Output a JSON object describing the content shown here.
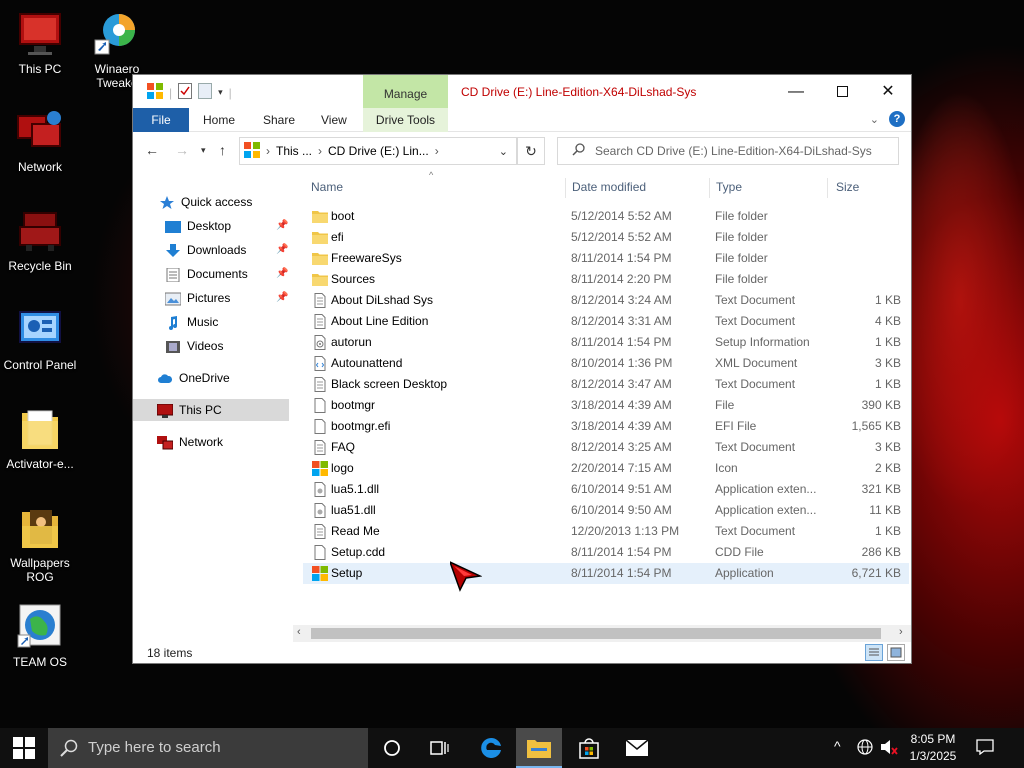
{
  "desktop": {
    "icons": [
      {
        "label": "This PC"
      },
      {
        "label": "Winaero Tweake"
      },
      {
        "label": "Network"
      },
      {
        "label": "Recycle Bin"
      },
      {
        "label": "Control Panel"
      },
      {
        "label": "Activator-e..."
      },
      {
        "label": "Wallpapers ROG"
      },
      {
        "label": "TEAM OS"
      }
    ]
  },
  "window": {
    "title": "CD Drive (E:) Line-Edition-X64-DiLshad-Sys",
    "manage_tab": "Manage",
    "ribbon_tabs": [
      "File",
      "Home",
      "Share",
      "View",
      "Drive Tools"
    ],
    "address": {
      "crumbs": [
        "This ...",
        "CD Drive (E:) Lin..."
      ]
    },
    "search_placeholder": "Search CD Drive (E:) Line-Edition-X64-DiLshad-Sys",
    "nav": [
      {
        "label": "Quick access",
        "icon": "star-icon"
      },
      {
        "label": "Desktop",
        "icon": "desktop-icon",
        "pinned": true
      },
      {
        "label": "Downloads",
        "icon": "download-icon",
        "pinned": true
      },
      {
        "label": "Documents",
        "icon": "documents-icon",
        "pinned": true
      },
      {
        "label": "Pictures",
        "icon": "pictures-icon",
        "pinned": true
      },
      {
        "label": "Music",
        "icon": "music-icon"
      },
      {
        "label": "Videos",
        "icon": "videos-icon"
      },
      {
        "label": "OneDrive",
        "icon": "cloud-icon"
      },
      {
        "label": "This PC",
        "icon": "computer-icon"
      },
      {
        "label": "Network",
        "icon": "network-icon"
      }
    ],
    "columns": [
      "Name",
      "Date modified",
      "Type",
      "Size"
    ],
    "files": [
      {
        "name": "boot",
        "date": "5/12/2014 5:52 AM",
        "type": "File folder",
        "size": "",
        "icon": "folder-icon"
      },
      {
        "name": "efi",
        "date": "5/12/2014 5:52 AM",
        "type": "File folder",
        "size": "",
        "icon": "folder-icon"
      },
      {
        "name": "FreewareSys",
        "date": "8/11/2014 1:54 PM",
        "type": "File folder",
        "size": "",
        "icon": "folder-icon"
      },
      {
        "name": "Sources",
        "date": "8/11/2014 2:20 PM",
        "type": "File folder",
        "size": "",
        "icon": "folder-icon"
      },
      {
        "name": "About DiLshad Sys",
        "date": "8/12/2014 3:24 AM",
        "type": "Text Document",
        "size": "1 KB",
        "icon": "text-file-icon"
      },
      {
        "name": "About Line Edition",
        "date": "8/12/2014 3:31 AM",
        "type": "Text Document",
        "size": "4 KB",
        "icon": "text-file-icon"
      },
      {
        "name": "autorun",
        "date": "8/11/2014 1:54 PM",
        "type": "Setup Information",
        "size": "1 KB",
        "icon": "setup-info-icon"
      },
      {
        "name": "Autounattend",
        "date": "8/10/2014 1:36 PM",
        "type": "XML Document",
        "size": "3 KB",
        "icon": "xml-file-icon"
      },
      {
        "name": "Black screen Desktop",
        "date": "8/12/2014 3:47 AM",
        "type": "Text Document",
        "size": "1 KB",
        "icon": "text-file-icon"
      },
      {
        "name": "bootmgr",
        "date": "3/18/2014 4:39 AM",
        "type": "File",
        "size": "390 KB",
        "icon": "file-icon"
      },
      {
        "name": "bootmgr.efi",
        "date": "3/18/2014 4:39 AM",
        "type": "EFI File",
        "size": "1,565 KB",
        "icon": "file-icon"
      },
      {
        "name": "FAQ",
        "date": "8/12/2014 3:25 AM",
        "type": "Text Document",
        "size": "3 KB",
        "icon": "text-file-icon"
      },
      {
        "name": "logo",
        "date": "2/20/2014 7:15 AM",
        "type": "Icon",
        "size": "2 KB",
        "icon": "windows-logo-icon"
      },
      {
        "name": "lua5.1.dll",
        "date": "6/10/2014 9:51 AM",
        "type": "Application exten...",
        "size": "321 KB",
        "icon": "dll-file-icon"
      },
      {
        "name": "lua51.dll",
        "date": "6/10/2014 9:50 AM",
        "type": "Application exten...",
        "size": "11 KB",
        "icon": "dll-file-icon"
      },
      {
        "name": "Read Me",
        "date": "12/20/2013 1:13 PM",
        "type": "Text Document",
        "size": "1 KB",
        "icon": "text-file-icon"
      },
      {
        "name": "Setup.cdd",
        "date": "8/11/2014 1:54 PM",
        "type": "CDD File",
        "size": "286 KB",
        "icon": "file-icon"
      },
      {
        "name": "Setup",
        "date": "8/11/2014 1:54 PM",
        "type": "Application",
        "size": "6,721 KB",
        "icon": "windows-logo-icon"
      }
    ],
    "status": "18 items"
  },
  "taskbar": {
    "search_placeholder": "Type here to search",
    "time": "8:05 PM",
    "date": "1/3/2025"
  },
  "colors": {
    "file_tab": "#1e5fa8",
    "manage_tab": "#c3e6a6",
    "title_text": "#c00000",
    "selection": "#e5f0fb",
    "taskbar": "#101010"
  }
}
